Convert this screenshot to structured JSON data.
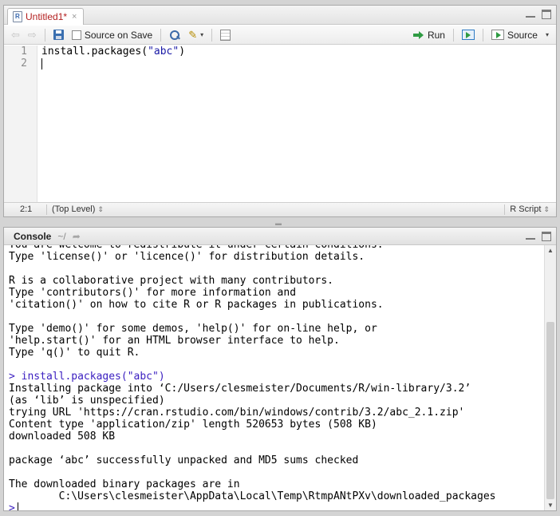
{
  "editor": {
    "tab_title": "Untitled1*",
    "close_glyph": "×",
    "toolbar": {
      "source_on_save": "Source on Save",
      "run": "Run",
      "source": "Source",
      "dropdown_glyph": "▾",
      "icons": [
        "back-arrow-icon",
        "forward-arrow-icon",
        "save-icon",
        "search-icon",
        "magic-wand-icon",
        "notebook-icon",
        "run-icon",
        "rerun-icon",
        "source-icon"
      ]
    },
    "lines": [
      {
        "no": "1",
        "prefix": "install.packages(",
        "string": "\"abc\"",
        "suffix": ")"
      },
      {
        "no": "2",
        "prefix": "",
        "string": "",
        "suffix": ""
      }
    ],
    "status": {
      "position": "2:1",
      "scope": "(Top Level)",
      "file_type": "R Script",
      "updown_glyph": "⇕"
    }
  },
  "console": {
    "title": "Console",
    "working_dir": "~/",
    "output_lines": [
      "You are welcome to redistribute it under certain conditions.",
      "Type 'license()' or 'licence()' for distribution details.",
      "",
      "R is a collaborative project with many contributors.",
      "Type 'contributors()' for more information and",
      "'citation()' on how to cite R or R packages in publications.",
      "",
      "Type 'demo()' for some demos, 'help()' for on-line help, or",
      "'help.start()' for an HTML browser interface to help.",
      "Type 'q()' to quit R.",
      ""
    ],
    "command": "> install.packages(\"abc\")",
    "result_lines": [
      "Installing package into ‘C:/Users/clesmeister/Documents/R/win-library/3.2’",
      "(as ‘lib’ is unspecified)",
      "trying URL 'https://cran.rstudio.com/bin/windows/contrib/3.2/abc_2.1.zip'",
      "Content type 'application/zip' length 520653 bytes (508 KB)",
      "downloaded 508 KB",
      "",
      "package ‘abc’ successfully unpacked and MD5 sums checked",
      "",
      "The downloaded binary packages are in",
      "        C:\\Users\\clesmeister\\AppData\\Local\\Temp\\RtmpANtPXv\\downloaded_packages"
    ],
    "prompt": ">"
  },
  "colors": {
    "tab_title": "#b32020",
    "command": "#3a1ec0",
    "string": "#1a1aa6"
  }
}
